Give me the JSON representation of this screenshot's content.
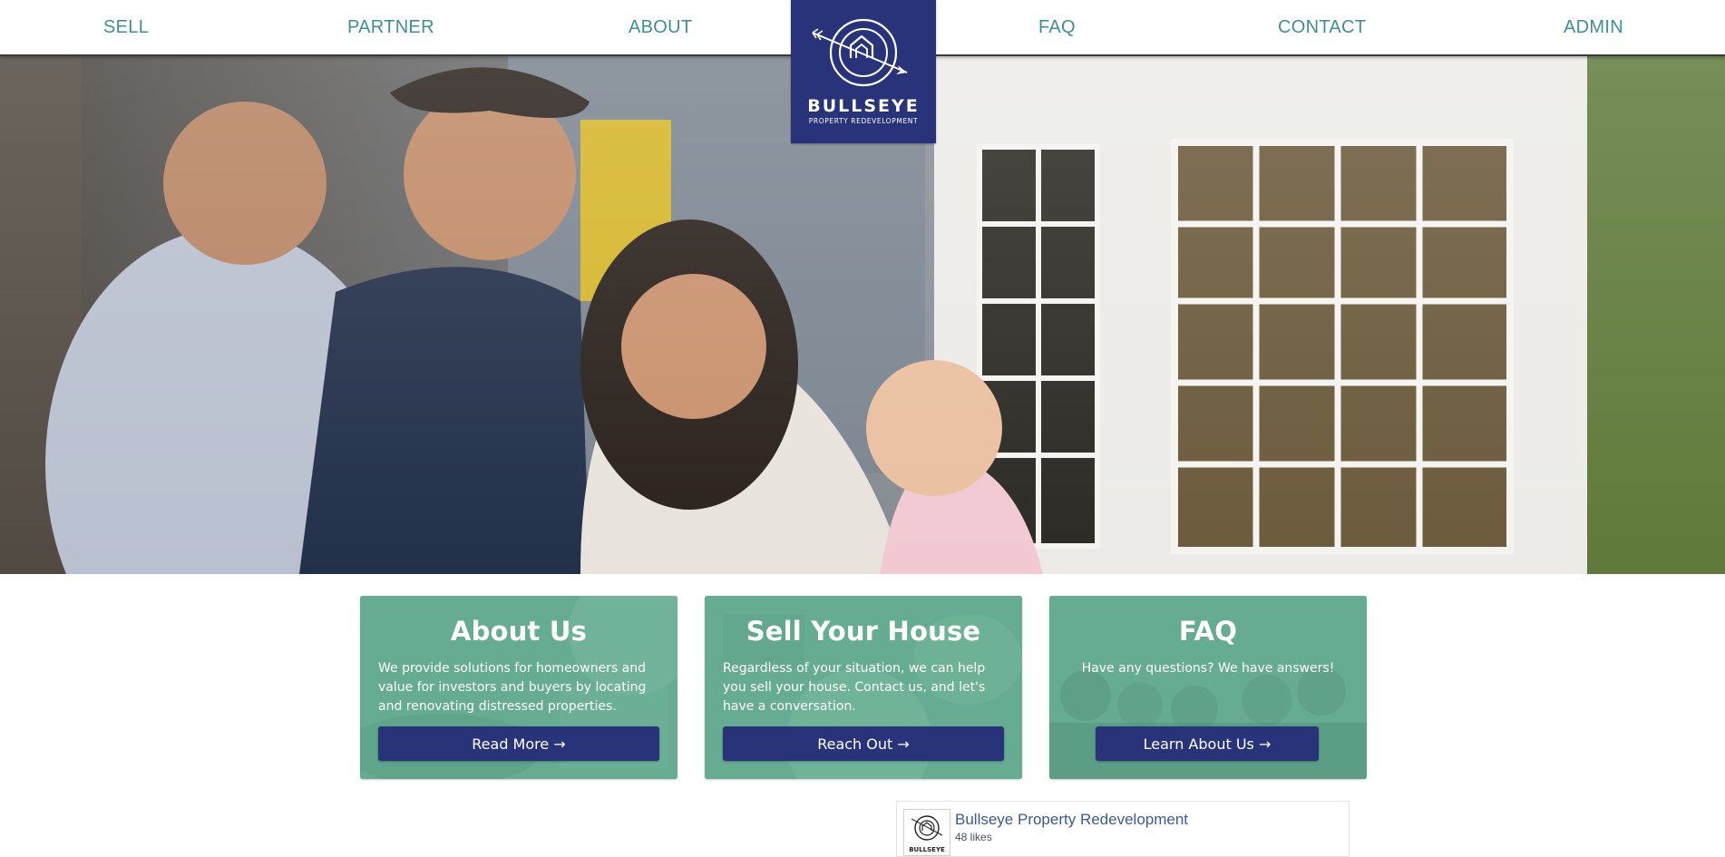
{
  "nav": {
    "items": [
      {
        "label": "SELL"
      },
      {
        "label": "PARTNER"
      },
      {
        "label": "ABOUT"
      },
      {
        "label": "FAQ"
      },
      {
        "label": "CONTACT"
      },
      {
        "label": "ADMIN"
      }
    ]
  },
  "logo": {
    "name": "BULLSEYE",
    "tagline": "PROPERTY REDEVELOPMENT"
  },
  "hero": {
    "image": "family-in-front-of-house-photo"
  },
  "cards": [
    {
      "title": "About Us",
      "text": "We provide solutions for homeowners and value for investors and buyers by locating and renovating distressed properties.",
      "button": "Read More →"
    },
    {
      "title": "Sell Your House",
      "text": "Regardless of your situation, we can help you sell your house. Contact us, and let's have a conversation.",
      "button": "Reach Out →"
    },
    {
      "title": "FAQ",
      "text": "Have any questions? We have answers!",
      "button": "Learn About Us →"
    }
  ],
  "facebook": {
    "page_name": "Bullseye Property Redevelopment",
    "likes": "48 likes",
    "thumb_text": "BULLSEYE"
  },
  "colors": {
    "nav_link": "#3f8e9b",
    "brand_navy": "#28337a",
    "card_green": "#66ac93",
    "fb_link": "#3b5998"
  }
}
